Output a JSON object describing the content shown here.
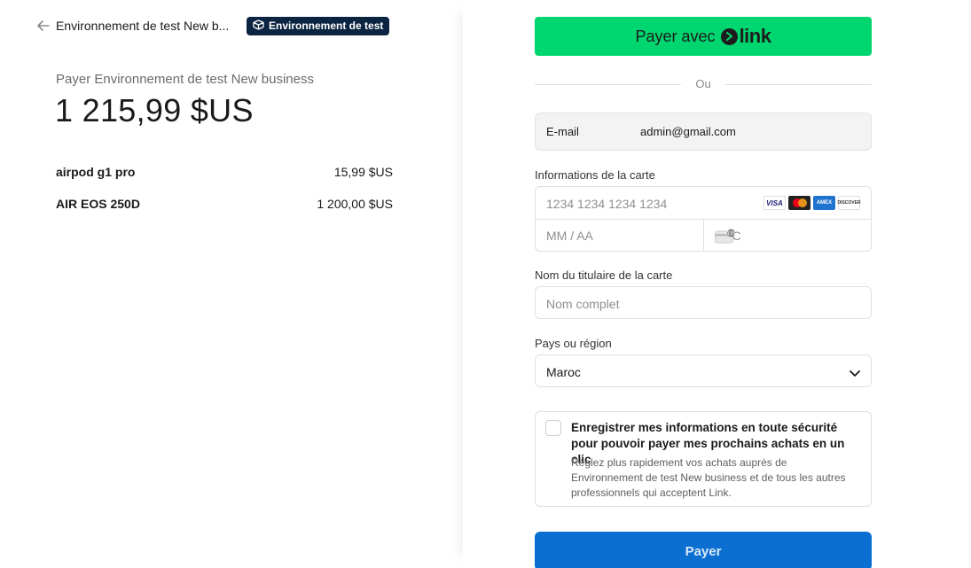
{
  "header": {
    "business_name": "Environnement de test New b...",
    "test_badge": "Environnement de test"
  },
  "summary": {
    "pay_label": "Payer Environnement de test New business",
    "total": "1 215,99 $US",
    "items": [
      {
        "name": "airpod g1 pro",
        "price": "15,99 $US"
      },
      {
        "name": "AIR EOS 250D",
        "price": "1 200,00 $US"
      }
    ]
  },
  "link_button": {
    "label": "Payer avec",
    "brand": "link"
  },
  "divider": "Ou",
  "email": {
    "label": "E-mail",
    "value": "admin@gmail.com"
  },
  "card": {
    "label": "Informations de la carte",
    "number_placeholder": "1234 1234 1234 1234",
    "expiry_placeholder": "MM / AA",
    "cvc_placeholder": "CVC",
    "brands": [
      "VISA",
      "mastercard",
      "AMEX",
      "DISCOVER"
    ]
  },
  "holder": {
    "label": "Nom du titulaire de la carte",
    "placeholder": "Nom complet"
  },
  "country": {
    "label": "Pays ou région",
    "value": "Maroc"
  },
  "save_info": {
    "title": "Enregistrer mes informations en toute sécurité pour pouvoir payer mes prochains achats en un clic",
    "description": "Réglez plus rapidement vos achats auprès de Environnement de test New business et de tous les autres professionnels qui acceptent Link.",
    "checked": false
  },
  "pay_button": "Payer",
  "colors": {
    "link_green": "#00d66f",
    "pay_blue": "#0a6fd1",
    "badge_navy": "#0b2441"
  }
}
